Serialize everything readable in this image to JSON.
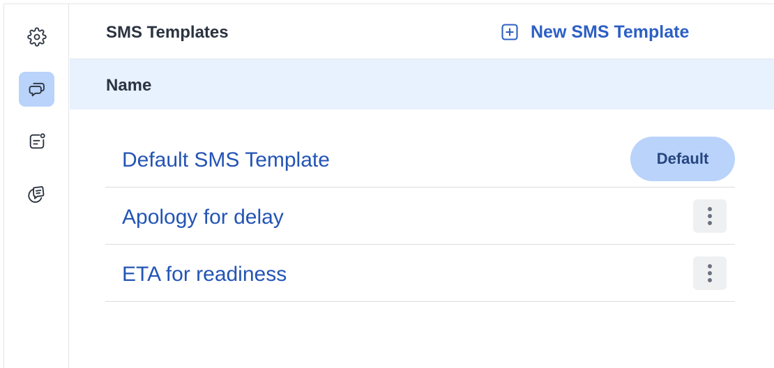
{
  "sidebar": {
    "items": [
      {
        "icon": "gear-icon",
        "active": false
      },
      {
        "icon": "chat-bubbles-icon",
        "active": true
      },
      {
        "icon": "message-notification-icon",
        "active": false
      },
      {
        "icon": "sticky-note-chat-icon",
        "active": false
      }
    ]
  },
  "header": {
    "title": "SMS Templates",
    "new_button_label": "New SMS Template",
    "new_button_icon": "plus-square-icon"
  },
  "table": {
    "column_header": "Name",
    "rows": [
      {
        "name": "Default SMS Template",
        "badge": "Default"
      },
      {
        "name": "Apology for delay",
        "actions_icon": "more-vertical-icon"
      },
      {
        "name": "ETA for readiness",
        "actions_icon": "more-vertical-icon"
      }
    ]
  },
  "colors": {
    "accent": "#2d5fc4",
    "active_highlight": "#b9d3fb",
    "header_band": "#e8f1fe"
  }
}
